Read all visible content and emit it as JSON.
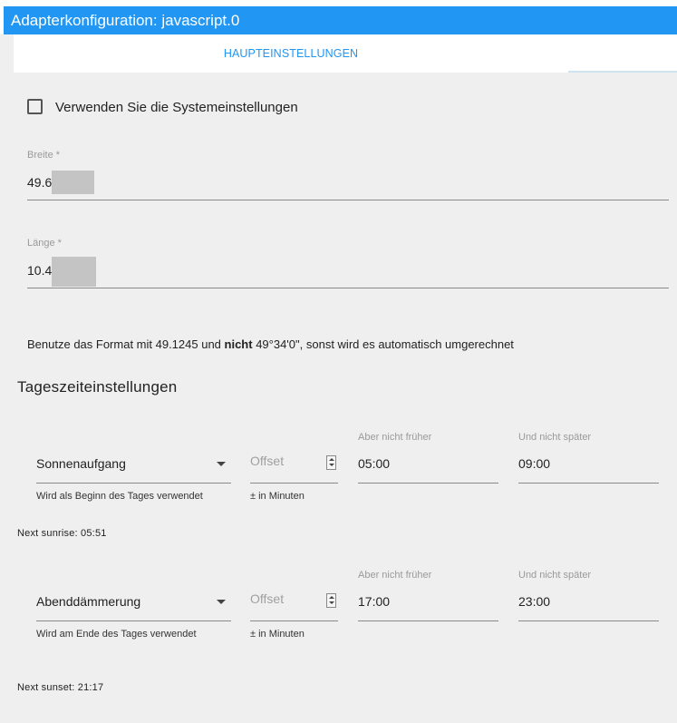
{
  "window": {
    "title": "Adapterkonfiguration: javascript.0"
  },
  "tabs": [
    {
      "label": "HAUPTEINSTELLUNGEN"
    }
  ],
  "system_settings": {
    "label": "Verwenden Sie die Systemeinstellungen",
    "checked": false
  },
  "latitude": {
    "label": "Breite *",
    "value": "49.6"
  },
  "longitude": {
    "label": "Länge *",
    "value": "10.4"
  },
  "format_hint": {
    "part1": "Benutze das Format mit 49.1245 und ",
    "bold": "nicht",
    "part2": " 49°34'0\", sonst wird es automatisch umgerechnet"
  },
  "section": {
    "title": "Tageszeiteinstellungen"
  },
  "sunrise_row": {
    "select_value": "Sonnenaufgang",
    "select_helper": "Wird als Beginn des Tages verwendet",
    "offset_placeholder": "Offset",
    "offset_helper": "± in Minuten",
    "not_earlier_label": "Aber nicht früher",
    "not_earlier_value": "05:00",
    "not_later_label": "Und nicht später",
    "not_later_value": "09:00",
    "next_text": "Next sunrise: 05:51"
  },
  "sunset_row": {
    "select_value": "Abenddämmerung",
    "select_helper": "Wird am Ende des Tages verwendet",
    "offset_placeholder": "Offset",
    "offset_helper": "± in Minuten",
    "not_earlier_label": "Aber nicht früher",
    "not_earlier_value": "17:00",
    "not_later_label": "Und nicht später",
    "not_later_value": "23:00",
    "next_text": "Next sunset: 21:17"
  },
  "colors": {
    "accent": "#2196f3",
    "panel_bg": "#efefef"
  }
}
